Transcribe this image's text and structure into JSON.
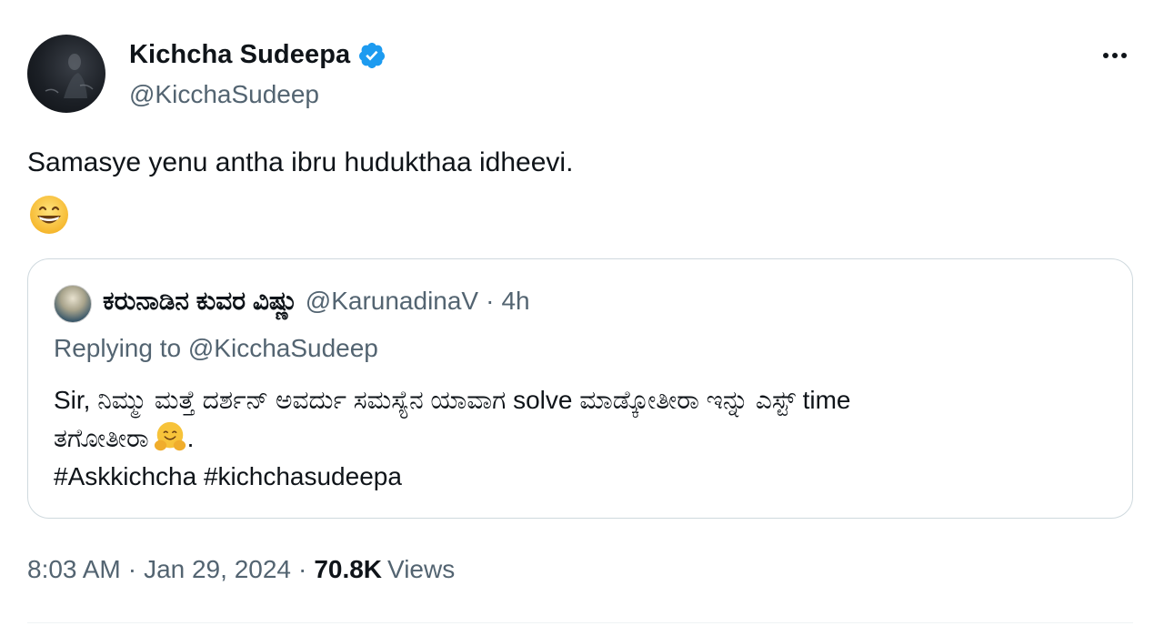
{
  "author": {
    "display_name": "Kichcha Sudeepa",
    "handle": "@KicchaSudeep",
    "verified": true,
    "avatar_icon": "profile-photo"
  },
  "tweet": {
    "text": "Samasye yenu antha ibru hudukthaa idheevi.",
    "emoji": "grinning-face-emoji"
  },
  "quoted_tweet": {
    "display_name": "ಕರುನಾಡಿನ ಕುವರ ವಿಷ್ಣು",
    "handle": "@KarunadinaV",
    "separator": "·",
    "time": "4h",
    "replying_prefix": "Replying to",
    "replying_to": "@KicchaSudeep",
    "line1": "Sir, ನಿಮ್ಮು ಮತ್ತೆ ದರ್ಶನ್ ಅವರ್ದು ಸಮಸ್ಯೆನ ಯಾವಾಗ solve ಮಾಡ್ಕೋತೀರಾ ಇನ್ನು ಎಸ್ಟ್  time",
    "line2": "ತಗೋತೀರಾ",
    "line2_suffix": ".",
    "hashtags": "#Askkichcha #kichchasudeepa",
    "emoji": "hugging-face-emoji"
  },
  "meta": {
    "time": "8:03 AM",
    "dot1": "·",
    "date": "Jan 29, 2024",
    "dot2": "·",
    "views_count": "70.8K",
    "views_label": "Views"
  },
  "colors": {
    "text_primary": "#0f1419",
    "text_secondary": "#536471",
    "verified_blue": "#1d9bf0",
    "border": "#cfd9de"
  }
}
